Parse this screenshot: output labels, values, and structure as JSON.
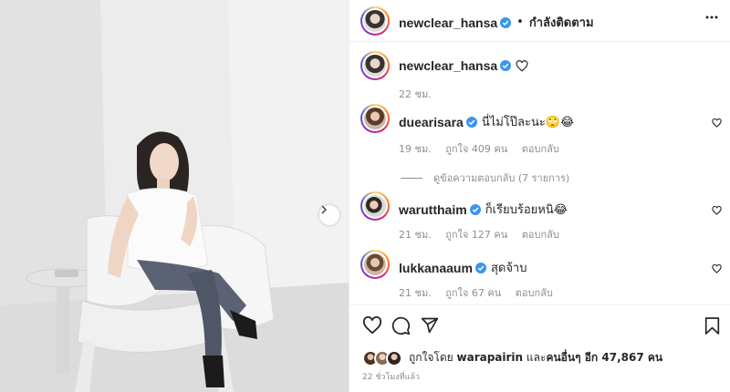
{
  "post": {
    "author": "newclear_hansa",
    "follow_separator": "•",
    "follow_label": "กำลังติดตาม"
  },
  "caption": {
    "username": "newclear_hansa",
    "time": "22 ชม."
  },
  "comments": [
    {
      "username": "duearisara",
      "text": "นี่ไม่โป๊ละนะ🙄😂",
      "time": "19 ชม.",
      "likes": "ถูกใจ 409 คน",
      "reply": "ตอบกลับ",
      "view_replies": "ดูข้อความตอบกลับ (7 รายการ)"
    },
    {
      "username": "warutthaim",
      "text": "ก็เรียบร้อยหนิ😂",
      "time": "21 ชม.",
      "likes": "ถูกใจ 127 คน",
      "reply": "ตอบกลับ"
    },
    {
      "username": "lukkanaaum",
      "text": "สุดจ้าบ",
      "time": "21 ชม.",
      "likes": "ถูกใจ 67 คน",
      "reply": "ตอบกลับ"
    }
  ],
  "likes_summary": {
    "prefix": "ถูกใจโดย ",
    "liker": "warapairin",
    "middle": " และ",
    "others": "คนอื่นๆ อีก 47,867 คน"
  },
  "time_ago": "22 ชั่วโมงที่แล้ว",
  "icons": {
    "verified": "verified-badge-icon",
    "more": "more-horizontal-icon",
    "like": "heart-icon",
    "comment": "comment-bubble-icon",
    "share": "paper-plane-icon",
    "save": "bookmark-icon",
    "carousel_next": "chevron-right-icon"
  },
  "colors": {
    "verified_blue": "#3897f0",
    "muted_text": "#8e8e8e",
    "primary_text": "#262626",
    "divider": "#efefef"
  }
}
